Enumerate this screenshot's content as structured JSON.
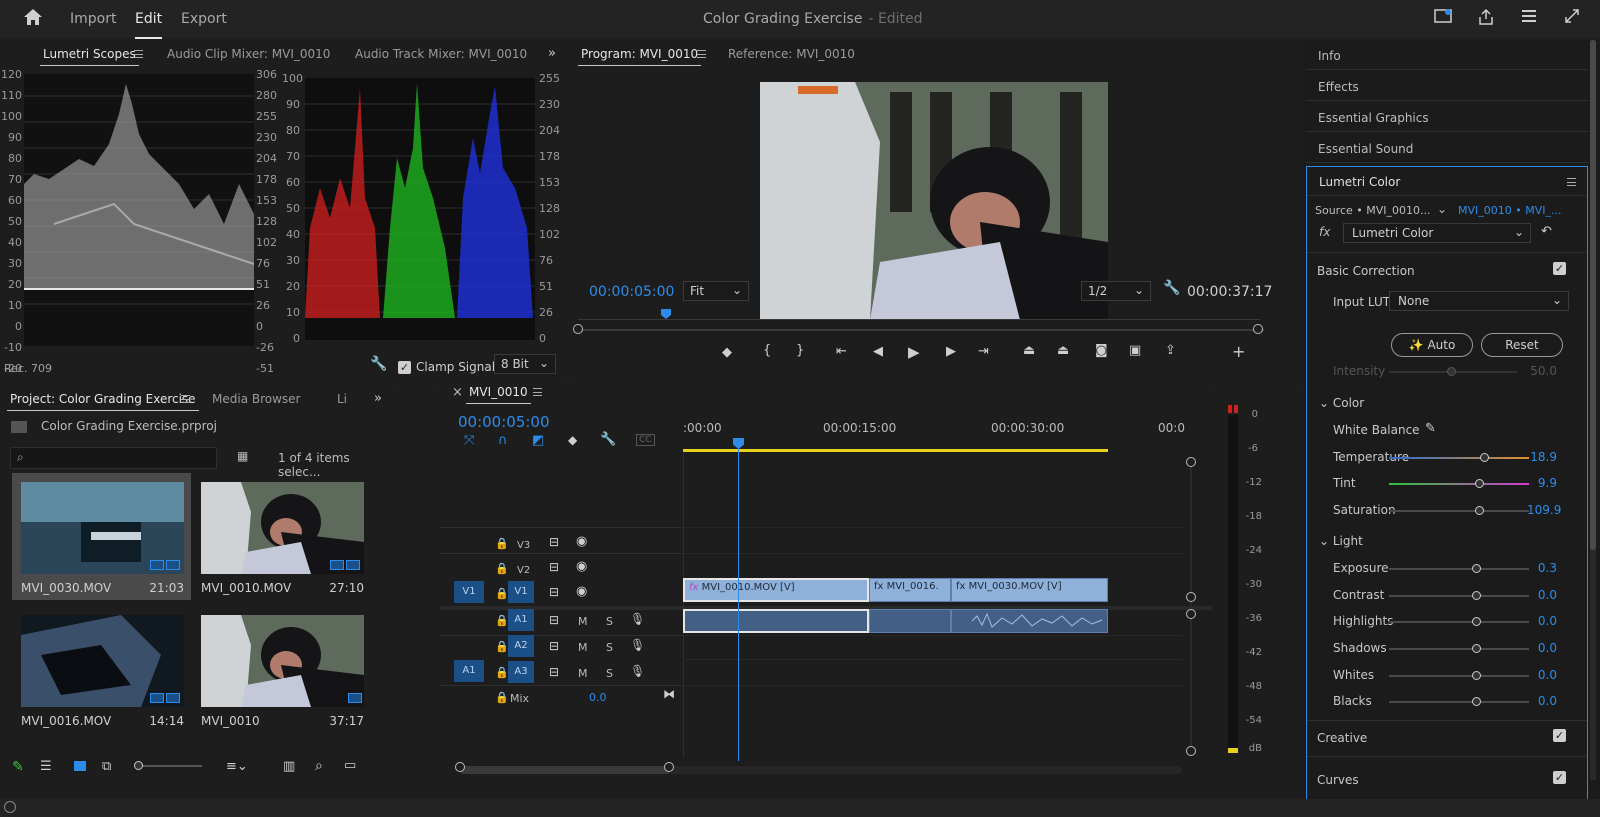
{
  "app": {
    "menus": [
      "Import",
      "Edit",
      "Export"
    ],
    "active_menu": "Edit",
    "project_title": "Color Grading Exercise",
    "edited_label": "- Edited"
  },
  "scopes": {
    "tabs": [
      "Lumetri Scopes",
      "Audio Clip Mixer: MVI_0010",
      "Audio Track Mixer: MVI_0010"
    ],
    "left_scale": [
      "120",
      "110",
      "100",
      "90",
      "80",
      "70",
      "60",
      "50",
      "40",
      "30",
      "20",
      "10",
      "0",
      "-10",
      "-20"
    ],
    "left_right_scale": [
      "306",
      "280",
      "255",
      "230",
      "204",
      "178",
      "153",
      "128",
      "102",
      "76",
      "51",
      "26",
      "0",
      "-26",
      "-51"
    ],
    "rgb_scale_left": [
      "100",
      "90",
      "80",
      "70",
      "60",
      "50",
      "40",
      "30",
      "20",
      "10",
      "0"
    ],
    "rgb_scale_right": [
      "255",
      "230",
      "204",
      "178",
      "153",
      "128",
      "102",
      "76",
      "51",
      "26",
      "0"
    ],
    "color_space": "Rec. 709",
    "clamp_label": "Clamp Signal",
    "bit_depth": "8 Bit"
  },
  "program": {
    "tabs": [
      "Program: MVI_0010",
      "Reference: MVI_0010"
    ],
    "timecode": "00:00:05:00",
    "fit": "Fit",
    "resolution": "1/2",
    "duration": "00:00:37:17"
  },
  "project": {
    "tabs": [
      "Project: Color Grading Exercise",
      "Media Browser",
      "Li"
    ],
    "file": "Color Grading Exercise.prproj",
    "selection": "1 of 4 items selec...",
    "items": [
      {
        "name": "MVI_0030.MOV",
        "duration": "21:03"
      },
      {
        "name": "MVI_0010.MOV",
        "duration": "27:10"
      },
      {
        "name": "MVI_0016.MOV",
        "duration": "14:14"
      },
      {
        "name": "MVI_0010",
        "duration": "37:17"
      }
    ]
  },
  "timeline": {
    "tab": "MVI_0010",
    "timecode": "00:00:05:00",
    "ruler": [
      ":00:00",
      "00:00:15:00",
      "00:00:30:00",
      "00:0"
    ],
    "tracks": {
      "v3": "V3",
      "v2": "V2",
      "v1": "V1",
      "a1": "A1",
      "a2": "A2",
      "a3": "A3",
      "src_v1": "V1",
      "src_a1": "A1",
      "mix": "Mix",
      "mix_val": "0.0",
      "m": "M",
      "s": "S"
    },
    "clips": {
      "c1": "MVI_0010.MOV [V]",
      "c2": "MVI_0016.",
      "c3": "MVI_0030.MOV [V]"
    },
    "meter_scale": [
      "0",
      "-6",
      "-12",
      "-18",
      "-24",
      "-30",
      "-36",
      "-42",
      "-48",
      "-54",
      "dB"
    ]
  },
  "right_panel": {
    "sections": [
      "Info",
      "Effects",
      "Essential Graphics",
      "Essential Sound"
    ],
    "lumetri": {
      "title": "Lumetri Color",
      "source": "Source • MVI_0010...",
      "target": "MVI_0010 • MVI_...",
      "effect": "Lumetri Color",
      "basic": "Basic Correction",
      "input_lut_label": "Input LUT",
      "input_lut": "None",
      "auto": "Auto",
      "reset": "Reset",
      "intensity": "Intensity",
      "intensity_val": "50.0",
      "color": "Color",
      "white_balance": "White Balance",
      "temperature": "Temperature",
      "temperature_val": "18.9",
      "tint": "Tint",
      "tint_val": "9.9",
      "saturation": "Saturation",
      "saturation_val": "109.9",
      "light": "Light",
      "exposure": "Exposure",
      "exposure_val": "0.3",
      "contrast": "Contrast",
      "contrast_val": "0.0",
      "highlights": "Highlights",
      "highlights_val": "0.0",
      "shadows": "Shadows",
      "shadows_val": "0.0",
      "whites": "Whites",
      "whites_val": "0.0",
      "blacks": "Blacks",
      "blacks_val": "0.0",
      "creative": "Creative",
      "curves": "Curves"
    }
  }
}
